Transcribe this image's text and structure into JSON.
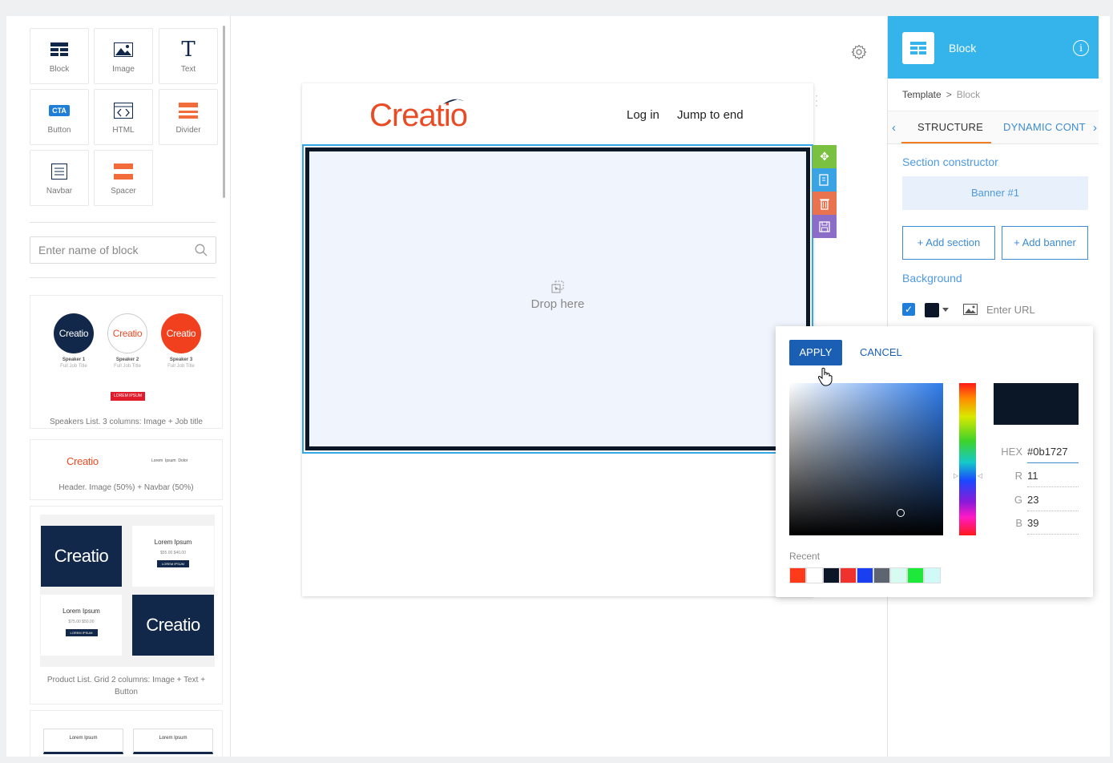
{
  "toolbox": {
    "items": [
      {
        "label": "Block"
      },
      {
        "label": "Image"
      },
      {
        "label": "Text"
      },
      {
        "label": "Button",
        "icon_text": "CTA"
      },
      {
        "label": "HTML"
      },
      {
        "label": "Divider"
      },
      {
        "label": "Navbar"
      },
      {
        "label": "Spacer"
      }
    ]
  },
  "search": {
    "placeholder": "Enter name of block"
  },
  "templates": [
    {
      "caption": "Speakers List. 3 columns: Image + Job title",
      "logo": "Creatio",
      "speakers": [
        "Speaker 1",
        "Speaker 2",
        "Speaker 3"
      ],
      "speaker_subtitle": "Full Job Title",
      "button": "LOREM IPSUM"
    },
    {
      "caption": "Header. Image (50%) + Navbar (50%)",
      "logo": "Creatio",
      "nav": "Lorem  Ipsum  Dolor"
    },
    {
      "caption": "Product List. Grid 2 columns: Image + Text + Button",
      "logo": "Creatio",
      "title": "Lorem Ipsum",
      "price1": "$55.00 $40.00",
      "price2": "$75.00 $50.00",
      "button": "LOREM IPSUM"
    },
    {
      "col1": "Lorem Ipsum",
      "col2": "Lorem Ipsum"
    }
  ],
  "canvas": {
    "logo": "Creatio",
    "nav": [
      "Log in",
      "Jump to end"
    ],
    "drop_text": "Drop here",
    "colors": {
      "logo": "#e94b25",
      "banner_border": "#0b1727",
      "selection": "#35a7e6"
    }
  },
  "block_actions": [
    {
      "name": "move",
      "color": "#7ac142"
    },
    {
      "name": "copy",
      "color": "#3aa3e3"
    },
    {
      "name": "delete",
      "color": "#e9734f"
    },
    {
      "name": "save",
      "color": "#8b6cc7"
    }
  ],
  "panel": {
    "title": "Block",
    "breadcrumb": {
      "parent": "Template",
      "separator": ">",
      "current": "Block"
    },
    "tabs": [
      "STRUCTURE",
      "DYNAMIC CONT"
    ],
    "section_constructor": "Section constructor",
    "banner_item": "Banner #1",
    "add_section": "+ Add section",
    "add_banner": "+ Add banner",
    "background_label": "Background",
    "url_placeholder": "Enter URL",
    "header_color": "#34b4eb"
  },
  "color_picker": {
    "apply": "APPLY",
    "cancel": "CANCEL",
    "hex_label": "HEX",
    "hex": "#0b1727",
    "r_label": "R",
    "r": "11",
    "g_label": "G",
    "g": "23",
    "b_label": "B",
    "b": "39",
    "recent_label": "Recent",
    "recent": [
      "#ff3a1a",
      "#ffffff",
      "#0b1727",
      "#f0322e",
      "#1a3ff0",
      "#5d6670",
      "#d7fbf1",
      "#1ee83a",
      "#cffaf8"
    ]
  }
}
